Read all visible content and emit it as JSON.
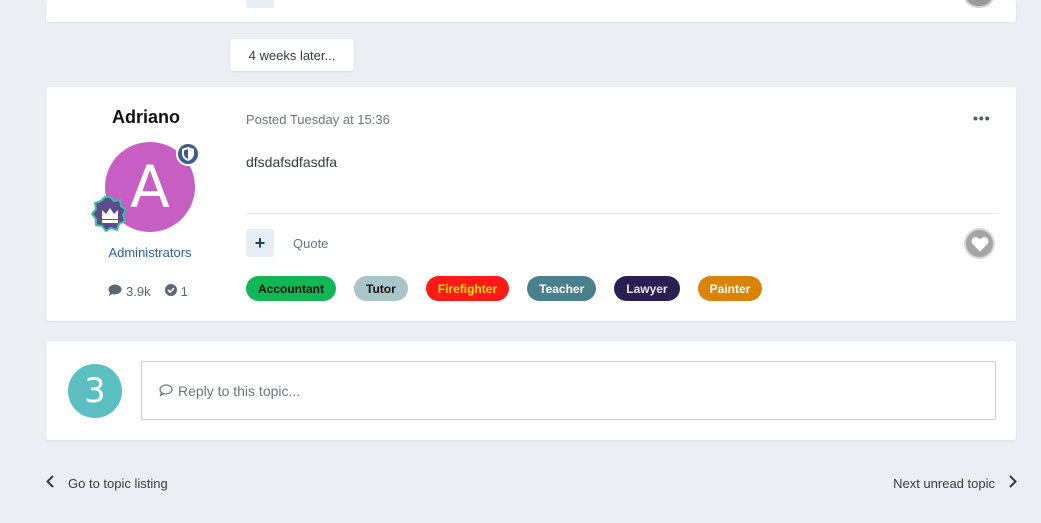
{
  "time_gap": "4 weeks later...",
  "post": {
    "author": "Adriano",
    "avatar_letter": "A",
    "avatar_color": "#c75ec4",
    "group": "Administrators",
    "posts_count": "3.9k",
    "solutions_count": "1",
    "posted_label": "Posted Tuesday at 15:36",
    "menu_label": "•••",
    "body": "dfsdafsdfasdfa",
    "plus_label": "+",
    "quote_label": "Quote",
    "tags": [
      {
        "label": "Accountant",
        "bg": "#13b654",
        "fg": "#111111"
      },
      {
        "label": "Tutor",
        "bg": "#a9c5c9",
        "fg": "#111111"
      },
      {
        "label": "Firefighter",
        "bg": "#ff1a1a",
        "fg": "#ffe000"
      },
      {
        "label": "Teacher",
        "bg": "#4a7f8c",
        "fg": "#ffffff"
      },
      {
        "label": "Lawyer",
        "bg": "#2a1f52",
        "fg": "#e6e6e6"
      },
      {
        "label": "Painter",
        "bg": "#d9830a",
        "fg": "#ffffff"
      }
    ]
  },
  "reply": {
    "avatar_letter": "3",
    "avatar_color": "#5bbfc1",
    "placeholder": "Reply to this topic..."
  },
  "nav": {
    "prev": "Go to topic listing",
    "next": "Next unread topic"
  },
  "icons": {
    "comment": "comment-icon",
    "check": "check-circle-icon",
    "heart": "heart-icon",
    "shield": "shield-icon",
    "crown": "crown-icon",
    "speech": "speech-bubble-icon",
    "chevron_left": "chevron-left-icon",
    "chevron_right": "chevron-right-icon"
  }
}
